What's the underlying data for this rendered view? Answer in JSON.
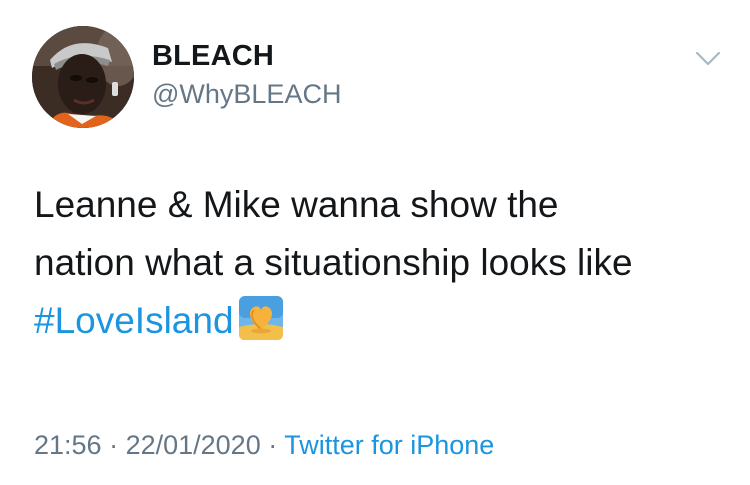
{
  "author": {
    "display_name": "BLEACH",
    "handle": "@WhyBLEACH"
  },
  "tweet": {
    "text_line_1": "Leanne & Mike wanna show the",
    "text_line_2": "nation what a situationship looks like",
    "hashtag": "#LoveIsland",
    "emoji": "heart-island-emoji"
  },
  "meta": {
    "time": "21:56",
    "separator": " · ",
    "date": "22/01/2020",
    "source": "Twitter for iPhone"
  },
  "icons": {
    "menu": "chevron-down-icon"
  },
  "colors": {
    "text": "#14171a",
    "secondary": "#657786",
    "link": "#1b95e0"
  }
}
